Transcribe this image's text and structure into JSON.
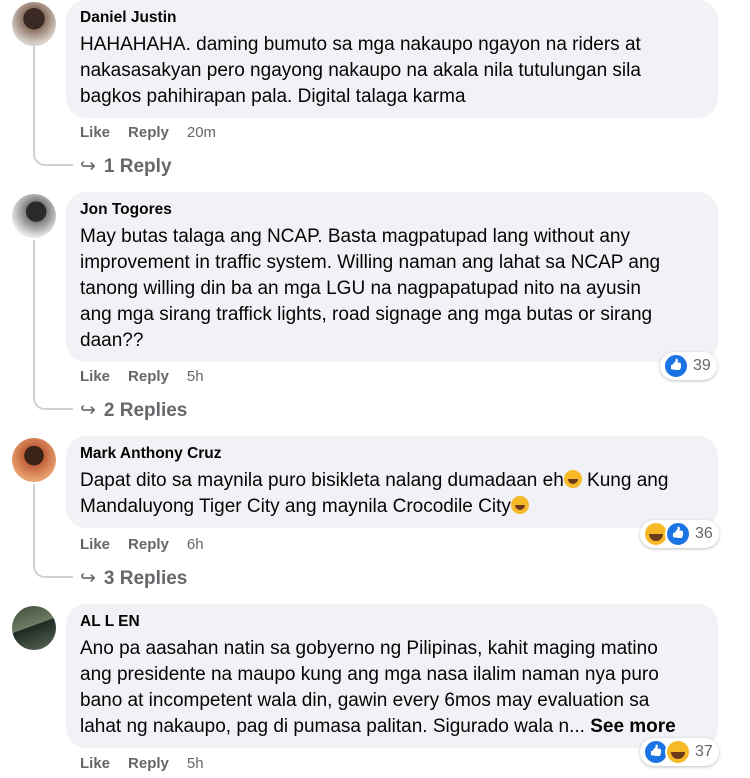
{
  "comments": [
    {
      "author": "Daniel Justin",
      "text": "HAHAHAHA. daming bumuto sa mga nakaupo ngayon na riders at\nnakasasakyan pero ngayong nakaupo na akala nila tutulungan sila\nbagkos pahihirapan pala. Digital talaga karma",
      "like": "Like",
      "reply": "Reply",
      "time": "20m",
      "replies": "1 Reply"
    },
    {
      "author": "Jon Togores",
      "text": "May butas talaga ang NCAP. Basta magpatupad lang without any\nimprovement in traffic system. Willing naman ang lahat sa NCAP ang\ntanong willing din ba an mga LGU na nagpapatupad nito na ayusin\nang mga sirang traffick lights, road signage ang mga butas or sirang\ndaan??",
      "like": "Like",
      "reply": "Reply",
      "time": "5h",
      "reactions": "39",
      "replies": "2 Replies"
    },
    {
      "author": "Mark Anthony Cruz",
      "text_line1": "Dapat dito sa maynila puro bisikleta nalang dumadaan eh",
      "text_line1b": " Kung ang",
      "text_line2": "Mandaluyong Tiger City ang maynila Crocodile City",
      "like": "Like",
      "reply": "Reply",
      "time": "6h",
      "reactions": "36",
      "replies": "3 Replies"
    },
    {
      "author": "AL L EN",
      "text": "Ano pa aasahan natin sa gobyerno ng Pilipinas, kahit maging matino\nang presidente na maupo kung ang mga nasa ilalim naman nya puro\nbano at incompetent wala din, gawin every 6mos may evaluation sa\nlahat ng nakaupo, pag di pumasa palitan. Sigurado wala n...",
      "see_more": "See more",
      "like": "Like",
      "reply": "Reply",
      "time": "5h",
      "reactions": "37"
    }
  ],
  "reply_arrow": "↪"
}
